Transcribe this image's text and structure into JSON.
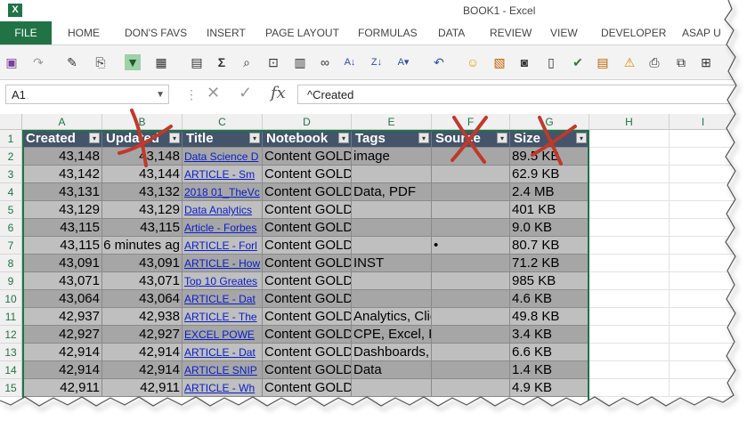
{
  "window": {
    "title": "BOOK1 - Excel",
    "logo": "X"
  },
  "ribbon_tabs": [
    "FILE",
    "HOME",
    "DON'S FAVS",
    "INSERT",
    "PAGE LAYOUT",
    "FORMULAS",
    "DATA",
    "REVIEW",
    "VIEW",
    "DEVELOPER",
    "ASAP U"
  ],
  "qat_icons": [
    "save-icon",
    "redo-icon",
    "format-painter-icon",
    "paste-special-icon",
    "filter-icon",
    "form-icon",
    "calculator-icon",
    "sum-icon",
    "print-preview-icon",
    "paste-link-icon",
    "table-icon",
    "link-icon",
    "sort-az-icon",
    "sort-za-icon",
    "sort-custom-icon",
    "undo-icon",
    "smiley-icon",
    "chart-icon",
    "camera-icon",
    "blank-document-icon",
    "check-icon",
    "notes-icon",
    "warning-icon",
    "printer-icon",
    "page-setup-icon",
    "fit-page-icon"
  ],
  "formula_bar": {
    "name_box": "A1",
    "formula": "^Created",
    "fx": "fx",
    "cancel": "✕",
    "enter": "✓"
  },
  "columns": [
    "A",
    "B",
    "C",
    "D",
    "E",
    "F",
    "G",
    "H",
    "I"
  ],
  "headers": [
    "Created",
    "Updated",
    "Title",
    "Notebook",
    "Tags",
    "Source",
    "Size"
  ],
  "rows": [
    {
      "n": "1"
    },
    {
      "n": "2",
      "created": "43,148",
      "updated": "43,148",
      "title": "Data Science D",
      "notebook": "Content GOLD",
      "tags": "image",
      "source": "",
      "size": "89.5 KB"
    },
    {
      "n": "3",
      "created": "43,142",
      "updated": "43,144",
      "title": "ARTICLE - Sm",
      "notebook": "Content GOLD",
      "tags": "",
      "source": "",
      "size": "62.9 KB"
    },
    {
      "n": "4",
      "created": "43,131",
      "updated": "43,132",
      "title": "2018 01_TheVc",
      "notebook": "Content GOLD",
      "tags": "Data, PDF",
      "source": "",
      "size": "2.4 MB"
    },
    {
      "n": "5",
      "created": "43,129",
      "updated": "43,129",
      "title": "Data Analytics",
      "notebook": "Content GOLD",
      "tags": "",
      "source": "",
      "size": "401 KB"
    },
    {
      "n": "6",
      "created": "43,115",
      "updated": "43,115",
      "title": "Article - Forbes",
      "notebook": "Content GOLD",
      "tags": "",
      "source": "",
      "size": "9.0 KB"
    },
    {
      "n": "7",
      "created": "43,115",
      "updated": "6 minutes ag",
      "title": "ARTICLE - Forl",
      "notebook": "Content GOLD",
      "tags": "",
      "source": "•",
      "size": "80.7 KB"
    },
    {
      "n": "8",
      "created": "43,091",
      "updated": "43,091",
      "title": "ARTICLE - How",
      "notebook": "Content GOLD",
      "tags": "INST",
      "source": "",
      "size": "71.2 KB"
    },
    {
      "n": "9",
      "created": "43,071",
      "updated": "43,071",
      "title": "Top 10 Greates",
      "notebook": "Content GOLD",
      "tags": "",
      "source": "",
      "size": "985 KB"
    },
    {
      "n": "10",
      "created": "43,064",
      "updated": "43,064",
      "title": "ARTICLE - Dat",
      "notebook": "Content GOLD",
      "tags": "",
      "source": "",
      "size": "4.6 KB"
    },
    {
      "n": "11",
      "created": "42,937",
      "updated": "42,938",
      "title": "ARTICLE - The",
      "notebook": "Content GOLD",
      "tags": "Analytics, ClientShare, D",
      "source": "",
      "size": "49.8 KB"
    },
    {
      "n": "12",
      "created": "42,927",
      "updated": "42,927",
      "title": "EXCEL POWE",
      "notebook": "Content GOLD",
      "tags": "CPE, Excel, PowerQuery",
      "source": "",
      "size": "3.4 KB"
    },
    {
      "n": "13",
      "created": "42,914",
      "updated": "42,914",
      "title": "ARTICLE - Dat",
      "notebook": "Content GOLD",
      "tags": "Dashboards, Data, Data A",
      "source": "",
      "size": "6.6 KB"
    },
    {
      "n": "14",
      "created": "42,914",
      "updated": "42,914",
      "title": "ARTICLE SNIP",
      "notebook": "Content GOLD",
      "tags": "Data",
      "source": "",
      "size": "1.4 KB"
    },
    {
      "n": "15",
      "created": "42,911",
      "updated": "42,911",
      "title": "ARTICLE - Wh",
      "notebook": "Content GOLD",
      "tags": "",
      "source": "",
      "size": "4.9 KB"
    }
  ],
  "colors": {
    "excel_green": "#217346",
    "header_fill": "#44546a",
    "band_light": "#bfbfbf",
    "band_dark": "#a6a6a6",
    "x_mark": "#c0392b",
    "link": "#0b20c8"
  },
  "annotations": [
    "x-mark-updated",
    "x-mark-source",
    "x-mark-size"
  ]
}
